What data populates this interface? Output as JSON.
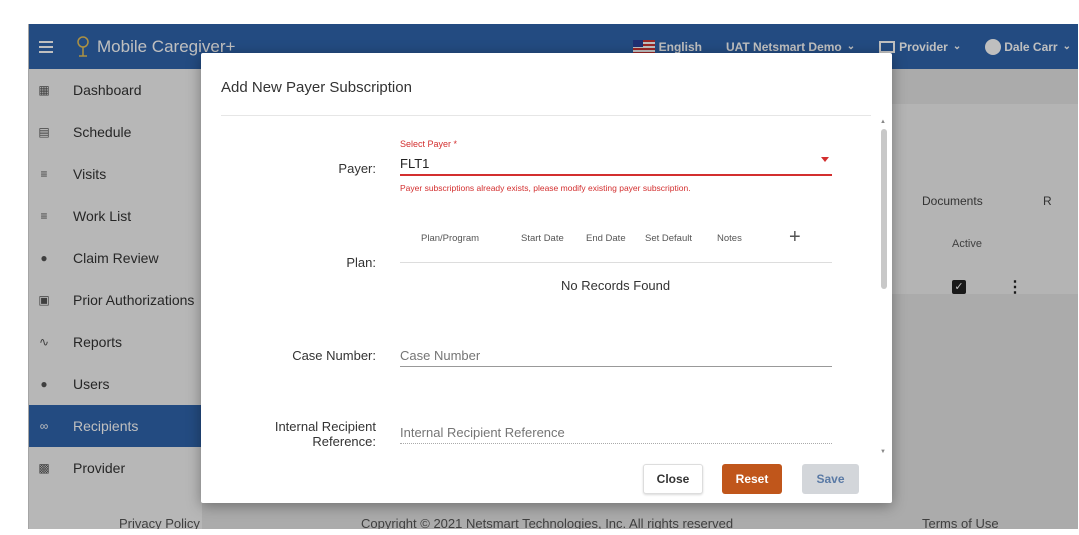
{
  "header": {
    "app_title": "Mobile Caregiver+",
    "language": "English",
    "environment": "UAT Netsmart Demo",
    "role": "Provider",
    "user": "Dale Carr",
    "brand_color": "#2f65ad"
  },
  "sidebar": {
    "items": [
      {
        "label": "Dashboard",
        "icon": "dashboard-icon"
      },
      {
        "label": "Schedule",
        "icon": "calendar-icon"
      },
      {
        "label": "Visits",
        "icon": "filter-icon"
      },
      {
        "label": "Work List",
        "icon": "list-icon"
      },
      {
        "label": "Claim Review",
        "icon": "alert-icon"
      },
      {
        "label": "Prior Authorizations",
        "icon": "calendar-event-icon"
      },
      {
        "label": "Reports",
        "icon": "trend-icon"
      },
      {
        "label": "Users",
        "icon": "users-icon"
      },
      {
        "label": "Recipients",
        "icon": "recipients-icon"
      },
      {
        "label": "Provider",
        "icon": "clipboard-icon"
      }
    ],
    "active": "Recipients"
  },
  "background": {
    "tab_documents": "Documents",
    "tab_r": "R",
    "column_active": "Active"
  },
  "footer": {
    "privacy": "Privacy Policy",
    "copyright": "Copyright © 2021 Netsmart Technologies, Inc. All rights reserved",
    "terms": "Terms of Use"
  },
  "modal": {
    "title": "Add New Payer Subscription",
    "payer_label": "Payer:",
    "payer_select_label": "Select Payer *",
    "payer_value": "FLT1",
    "payer_error": "Payer subscriptions already exists, please modify existing payer subscription.",
    "plan_label": "Plan:",
    "plan_columns": [
      "Plan/Program",
      "Start Date",
      "End Date",
      "Set Default",
      "Notes"
    ],
    "plan_empty": "No Records Found",
    "case_number_label": "Case Number:",
    "case_number_placeholder": "Case Number",
    "irr_label": "Internal Recipient Reference:",
    "irr_placeholder": "Internal Recipient Reference",
    "buttons": {
      "close": "Close",
      "reset": "Reset",
      "save": "Save"
    },
    "error_color": "#d32f2f",
    "reset_color": "#c0561b"
  }
}
